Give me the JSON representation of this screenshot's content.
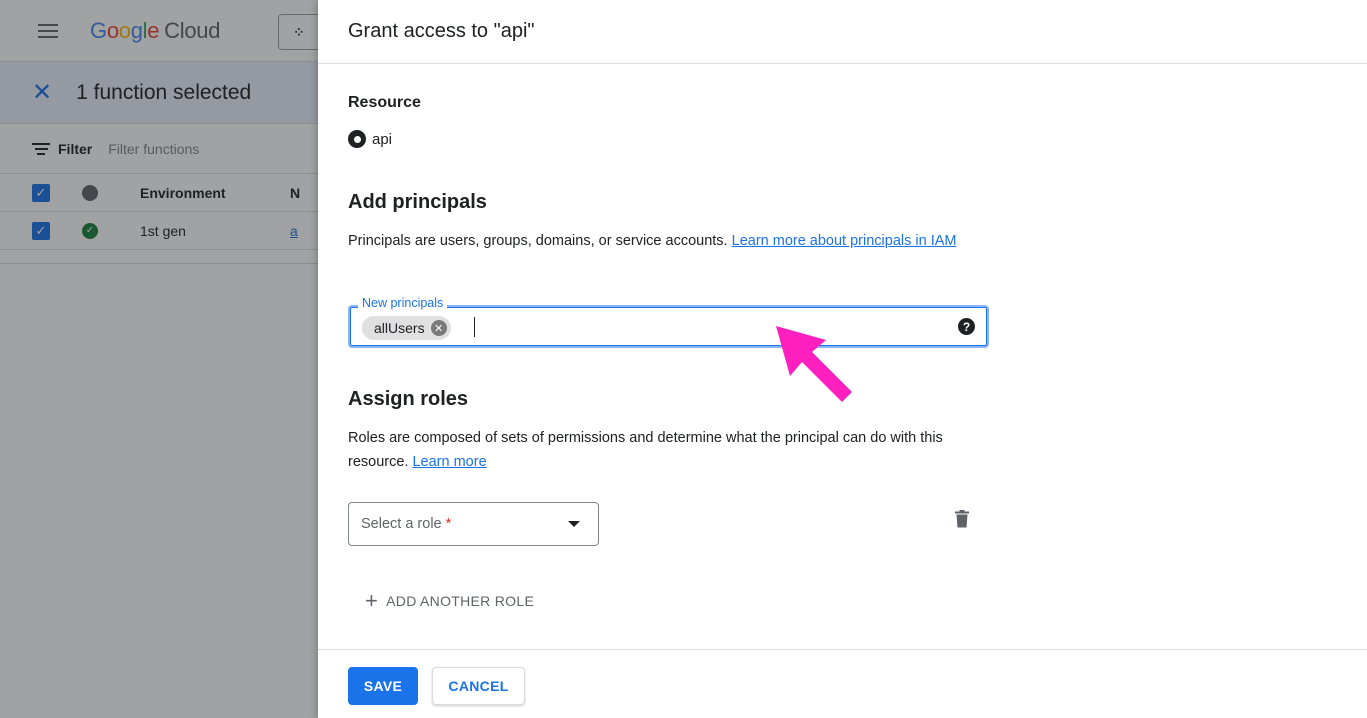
{
  "background": {
    "logo": {
      "google": "Google",
      "cloud": "Cloud"
    },
    "selection": {
      "text": "1 function selected"
    },
    "filter": {
      "label": "Filter",
      "placeholder": "Filter functions"
    },
    "table": {
      "headers": {
        "environment": "Environment",
        "name_partial": "N"
      },
      "row": {
        "environment": "1st gen",
        "name_partial": "a"
      }
    }
  },
  "panel": {
    "title": "Grant access to \"api\"",
    "resource": {
      "label": "Resource",
      "name": "api"
    },
    "principals": {
      "heading": "Add principals",
      "description": "Principals are users, groups, domains, or service accounts. ",
      "learn_more": "Learn more about principals in IAM",
      "field_label": "New principals",
      "chips": [
        "allUsers"
      ]
    },
    "roles": {
      "heading": "Assign roles",
      "description": "Roles are composed of sets of permissions and determine what the principal can do with this resource. ",
      "learn_more": "Learn more",
      "select_placeholder": "Select a role",
      "required_mark": "*",
      "add_another": "ADD ANOTHER ROLE"
    },
    "footer": {
      "save": "SAVE",
      "cancel": "CANCEL"
    }
  },
  "colors": {
    "accent": "#1a73e8",
    "annotation_arrow": "#ff1fbf",
    "required": "#d93025"
  },
  "icons": [
    "hamburger-menu-icon",
    "close-icon",
    "filter-icon",
    "resource-icon",
    "chip-remove-icon",
    "help-icon",
    "dropdown-arrow-icon",
    "trash-icon",
    "plus-icon"
  ]
}
